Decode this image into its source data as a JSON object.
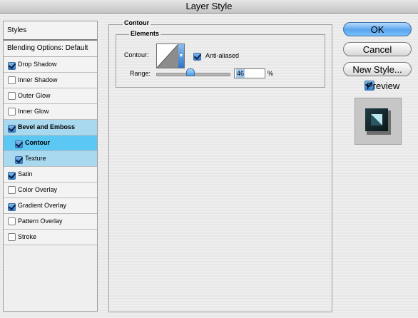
{
  "window": {
    "title": "Layer Style"
  },
  "styles_panel": {
    "header": "Styles",
    "blending_options": "Blending Options: Default",
    "items": [
      {
        "label": "Drop Shadow",
        "checked": true
      },
      {
        "label": "Inner Shadow",
        "checked": false
      },
      {
        "label": "Outer Glow",
        "checked": false
      },
      {
        "label": "Inner Glow",
        "checked": false
      },
      {
        "label": "Bevel and Emboss",
        "checked": true
      },
      {
        "label": "Contour",
        "checked": true
      },
      {
        "label": "Texture",
        "checked": true
      },
      {
        "label": "Satin",
        "checked": true
      },
      {
        "label": "Color Overlay",
        "checked": false
      },
      {
        "label": "Gradient Overlay",
        "checked": true
      },
      {
        "label": "Pattern Overlay",
        "checked": false
      },
      {
        "label": "Stroke",
        "checked": false
      }
    ]
  },
  "contour_section": {
    "title": "Contour",
    "elements_title": "Elements",
    "contour_label": "Contour:",
    "anti_aliased_label": "Anti-aliased",
    "anti_aliased_checked": true,
    "range_label": "Range:",
    "range_value": "46",
    "range_unit": "%",
    "range_fraction": 0.46
  },
  "buttons": {
    "ok": "OK",
    "cancel": "Cancel",
    "new_style": "New Style...",
    "preview_label": "Preview",
    "preview_checked": true
  },
  "colors": {
    "selected_row": "#5bc8f4",
    "highlight_row": "#a9d9ef",
    "accent_button": "#5aa5ee"
  }
}
